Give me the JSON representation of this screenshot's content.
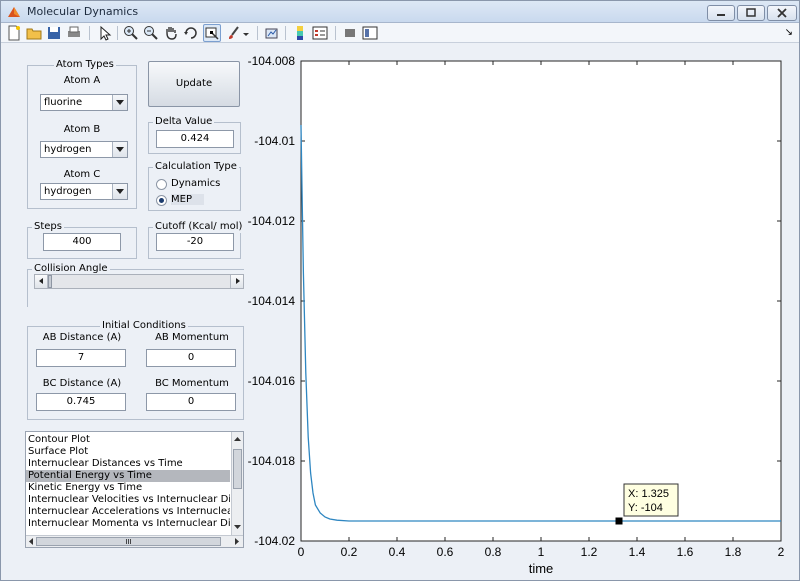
{
  "window": {
    "title": "Molecular Dynamics"
  },
  "toolbar": {
    "items": [
      "new-figure",
      "open-file",
      "save-figure",
      "print-figure",
      "edit-plot",
      "zoom-in",
      "zoom-out",
      "pan",
      "rotate-3d",
      "data-cursor",
      "brush",
      "link-plot",
      "insert-colorbar",
      "insert-legend",
      "hide-plot-tools",
      "show-plot-tools"
    ],
    "dock_glyph": "↘"
  },
  "atom_types": {
    "title": "Atom Types",
    "atom_a_label": "Atom A",
    "atom_a_value": "fluorine",
    "atom_b_label": "Atom B",
    "atom_b_value": "hydrogen",
    "atom_c_label": "Atom C",
    "atom_c_value": "hydrogen"
  },
  "update_button": "Update",
  "delta": {
    "title": "Delta Value",
    "value": "0.424"
  },
  "calc_type": {
    "title": "Calculation Type",
    "options": [
      "Dynamics",
      "MEP"
    ],
    "selected": "MEP"
  },
  "steps": {
    "title": "Steps",
    "value": "400"
  },
  "cutoff": {
    "title": "Cutoff (Kcal/ mol)",
    "value": "-20"
  },
  "collision": {
    "title": "Collision Angle",
    "position": 0.0
  },
  "initial": {
    "title": "Initial Conditions",
    "ab_distance_label": "AB Distance (A)",
    "ab_distance_value": "7",
    "ab_momentum_label": "AB Momentum",
    "ab_momentum_value": "0",
    "bc_distance_label": "BC Distance (A)",
    "bc_distance_value": "0.745",
    "bc_momentum_label": "BC Momentum",
    "bc_momentum_value": "0"
  },
  "plot_list": {
    "items": [
      "Contour Plot",
      "Surface Plot",
      "Internuclear Distances vs Time",
      "Potential Energy vs Time",
      "Kinetic Energy vs Time",
      "Internuclear Velocities vs Internuclear Distance",
      "Internuclear Accelerations vs Internuclear Distance",
      "Internuclear Momenta vs Internuclear Distance"
    ],
    "selected_index": 3,
    "scroll_grip": "III"
  },
  "chart_data": {
    "type": "line",
    "xlabel": "time",
    "ylabel": "",
    "title": "",
    "xlim": [
      0,
      2
    ],
    "ylim": [
      -104.02,
      -104.008
    ],
    "xticks": [
      "0",
      "0.2",
      "0.4",
      "0.6",
      "0.8",
      "1",
      "1.2",
      "1.4",
      "1.6",
      "1.8",
      "2"
    ],
    "yticks": [
      "-104.008",
      "-104.01",
      "-104.012",
      "-104.014",
      "-104.016",
      "-104.018",
      "-104.02"
    ],
    "series": [
      {
        "color": "#2e86c1",
        "x": [
          0,
          0.005,
          0.01,
          0.02,
          0.03,
          0.04,
          0.05,
          0.06,
          0.08,
          0.1,
          0.12,
          0.15,
          0.2,
          0.3,
          0.5,
          1.0,
          1.5,
          2.0
        ],
        "y": [
          -104.0096,
          -104.0115,
          -104.0133,
          -104.0158,
          -104.0174,
          -104.0183,
          -104.0188,
          -104.0191,
          -104.0193,
          -104.0194,
          -104.01945,
          -104.01948,
          -104.0195,
          -104.0195,
          -104.0195,
          -104.0195,
          -104.0195,
          -104.0195
        ]
      }
    ],
    "datatip": {
      "x": 1.325,
      "y": -104.0195,
      "text_x": "X: 1.325",
      "text_y": "Y: -104"
    }
  }
}
